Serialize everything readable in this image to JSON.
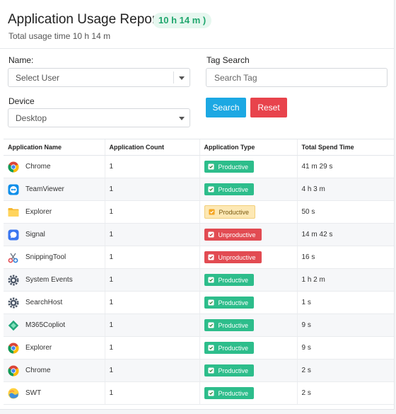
{
  "header": {
    "title": "Application Usage Report",
    "badge": "10 h 14 m )",
    "subtitle": "Total usage time 10 h 14 m"
  },
  "filters": {
    "name_label": "Name:",
    "name_value": "Select User",
    "device_label": "Device",
    "device_value": "Desktop",
    "tag_label": "Tag Search",
    "tag_placeholder": "Search Tag",
    "search_button": "Search",
    "reset_button": "Reset"
  },
  "table": {
    "headers": [
      "Application Name",
      "Application Count",
      "Application Type",
      "Total Spend Time"
    ],
    "rows": [
      {
        "name": "Chrome",
        "count": "1",
        "type": "Productive",
        "status": "productive",
        "time": "41 m 29 s",
        "icon": "chrome-icon"
      },
      {
        "name": "TeamViewer",
        "count": "1",
        "type": "Productive",
        "status": "productive",
        "time": "4 h 3 m",
        "icon": "teamviewer-icon"
      },
      {
        "name": "Explorer",
        "count": "1",
        "type": "Productive",
        "status": "neutral",
        "time": "50 s",
        "icon": "folder-icon"
      },
      {
        "name": "Signal",
        "count": "1",
        "type": "Unproductive",
        "status": "unproductive",
        "time": "14 m 42 s",
        "icon": "signal-icon"
      },
      {
        "name": "SnippingTool",
        "count": "1",
        "type": "Unproductive",
        "status": "unproductive",
        "time": "16 s",
        "icon": "snipping-tool-icon"
      },
      {
        "name": "System Events",
        "count": "1",
        "type": "Productive",
        "status": "productive",
        "time": "1 h 2 m",
        "icon": "gear-icon"
      },
      {
        "name": "SearchHost",
        "count": "1",
        "type": "Productive",
        "status": "productive",
        "time": "1 s",
        "icon": "gear-icon"
      },
      {
        "name": "M365Copliot",
        "count": "1",
        "type": "Productive",
        "status": "productive",
        "time": "9 s",
        "icon": "copilot-icon"
      },
      {
        "name": "Explorer",
        "count": "1",
        "type": "Productive",
        "status": "productive",
        "time": "9 s",
        "icon": "chrome-icon"
      },
      {
        "name": "Chrome",
        "count": "1",
        "type": "Productive",
        "status": "productive",
        "time": "2 s",
        "icon": "chrome-icon"
      },
      {
        "name": "SWT",
        "count": "1",
        "type": "Productive",
        "status": "productive",
        "time": "2 s",
        "icon": "swt-icon"
      }
    ]
  },
  "colors": {
    "productive": "#2dbd8b",
    "unproductive": "#e24b52",
    "neutral": "#fde8b4",
    "search_button": "#1ca8e3",
    "reset_button": "#e8434c",
    "badge_text": "#1fa66d"
  }
}
